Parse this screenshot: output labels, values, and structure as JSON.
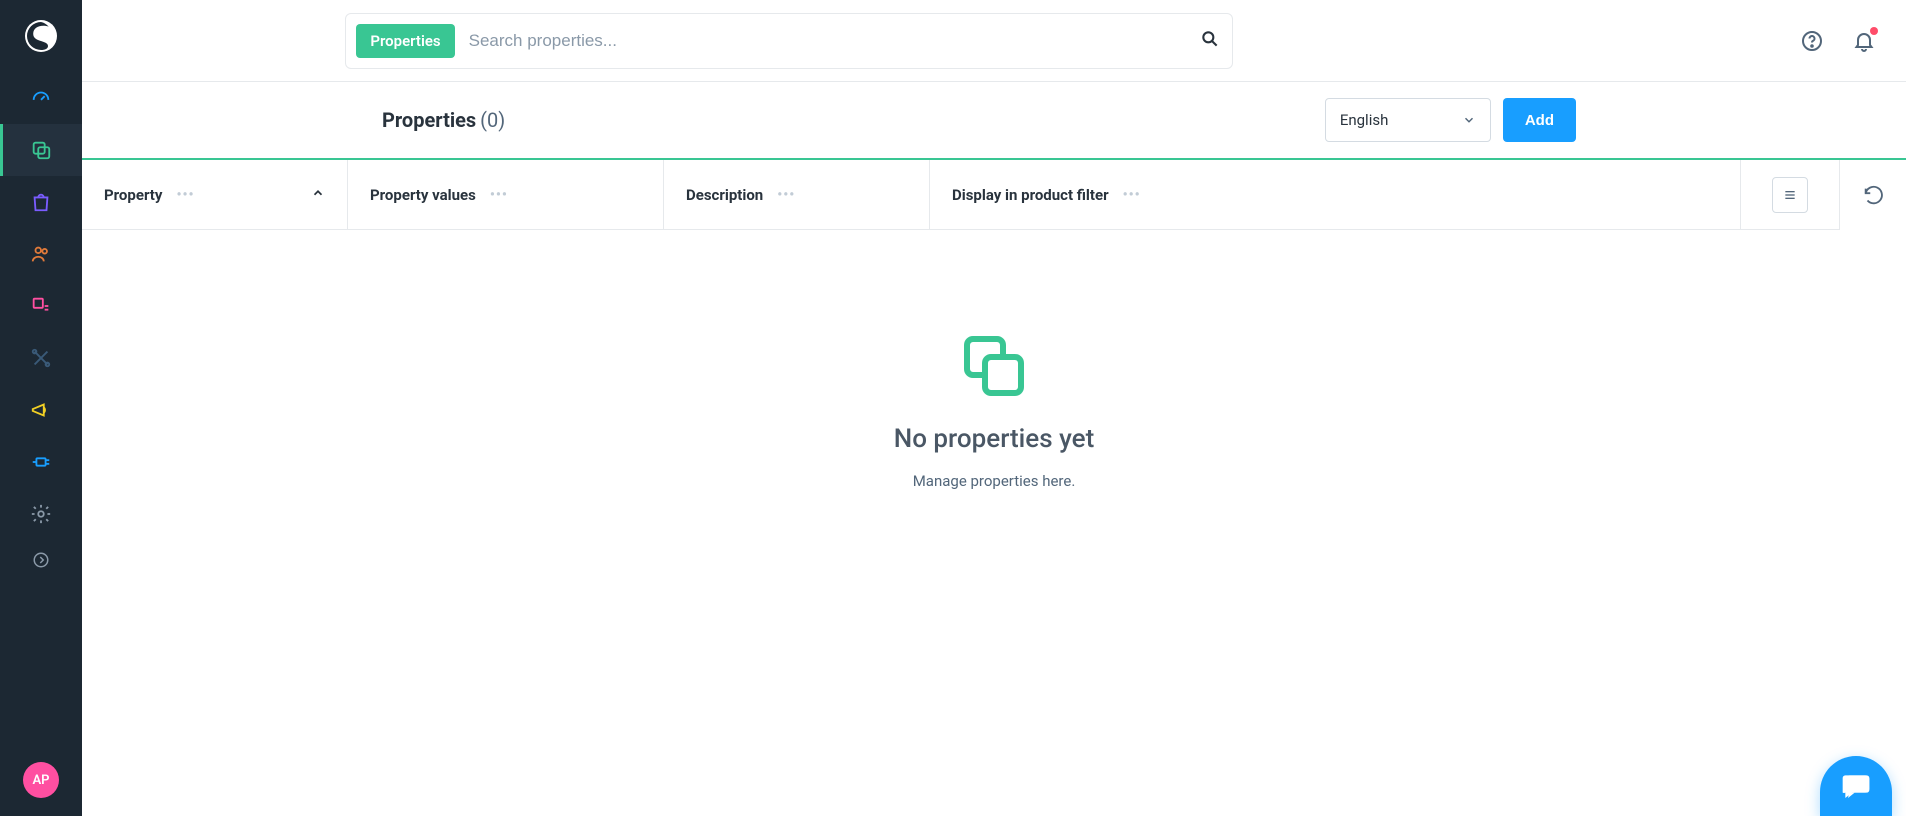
{
  "search": {
    "tag_label": "Properties",
    "placeholder": "Search properties..."
  },
  "avatar": {
    "initials": "AP"
  },
  "page": {
    "title": "Properties",
    "count_display": "(0)"
  },
  "language_picker": {
    "selected": "English"
  },
  "actions": {
    "add_label": "Add"
  },
  "columns": [
    {
      "label": "Property",
      "sortable": true,
      "sort_dir": "asc"
    },
    {
      "label": "Property values"
    },
    {
      "label": "Description"
    },
    {
      "label": "Display in product filter"
    }
  ],
  "empty_state": {
    "title": "No properties yet",
    "subtitle": "Manage properties here."
  }
}
